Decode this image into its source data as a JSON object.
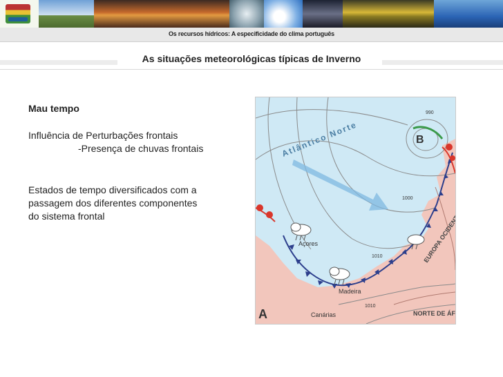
{
  "header": {
    "caption": "Os recursos hídricos: A especificidade do clima português",
    "tile_colors": [
      "#4f7fb8",
      "#b07a4d",
      "#a8431f",
      "#9aa4a6",
      "#3b6fbf",
      "#3a3a4e",
      "#c9b032",
      "#1f5f9a"
    ]
  },
  "slide": {
    "title": "As situações meteorológicas típicas de Inverno"
  },
  "content": {
    "heading": "Mau tempo",
    "line1": "Influência de Perturbações frontais",
    "line2": "-Presença de chuvas frontais",
    "line3": "Estados de tempo diversificados com a",
    "line4": "passagem dos diferentes componentes",
    "line5": "do sistema frontal"
  },
  "map": {
    "ocean_label": "Atlântico Norte",
    "low_label": "B",
    "high_label": "A",
    "isobar_990": "990",
    "isobar_1000": "1000",
    "isobar_1010a": "1010",
    "isobar_1010b": "1010",
    "azores": "Açores",
    "madeira": "Madeira",
    "canarias": "Canárias",
    "europe": "EUROPA OCIDENTAL",
    "africa": "NORTE DE ÁFRICA",
    "colors": {
      "sea": "#cfe9f5",
      "land": "#f2c6bc",
      "cold_front": "#2c3e8c",
      "warm_front": "#d9362b",
      "occluded": "#3a9a4a"
    }
  }
}
